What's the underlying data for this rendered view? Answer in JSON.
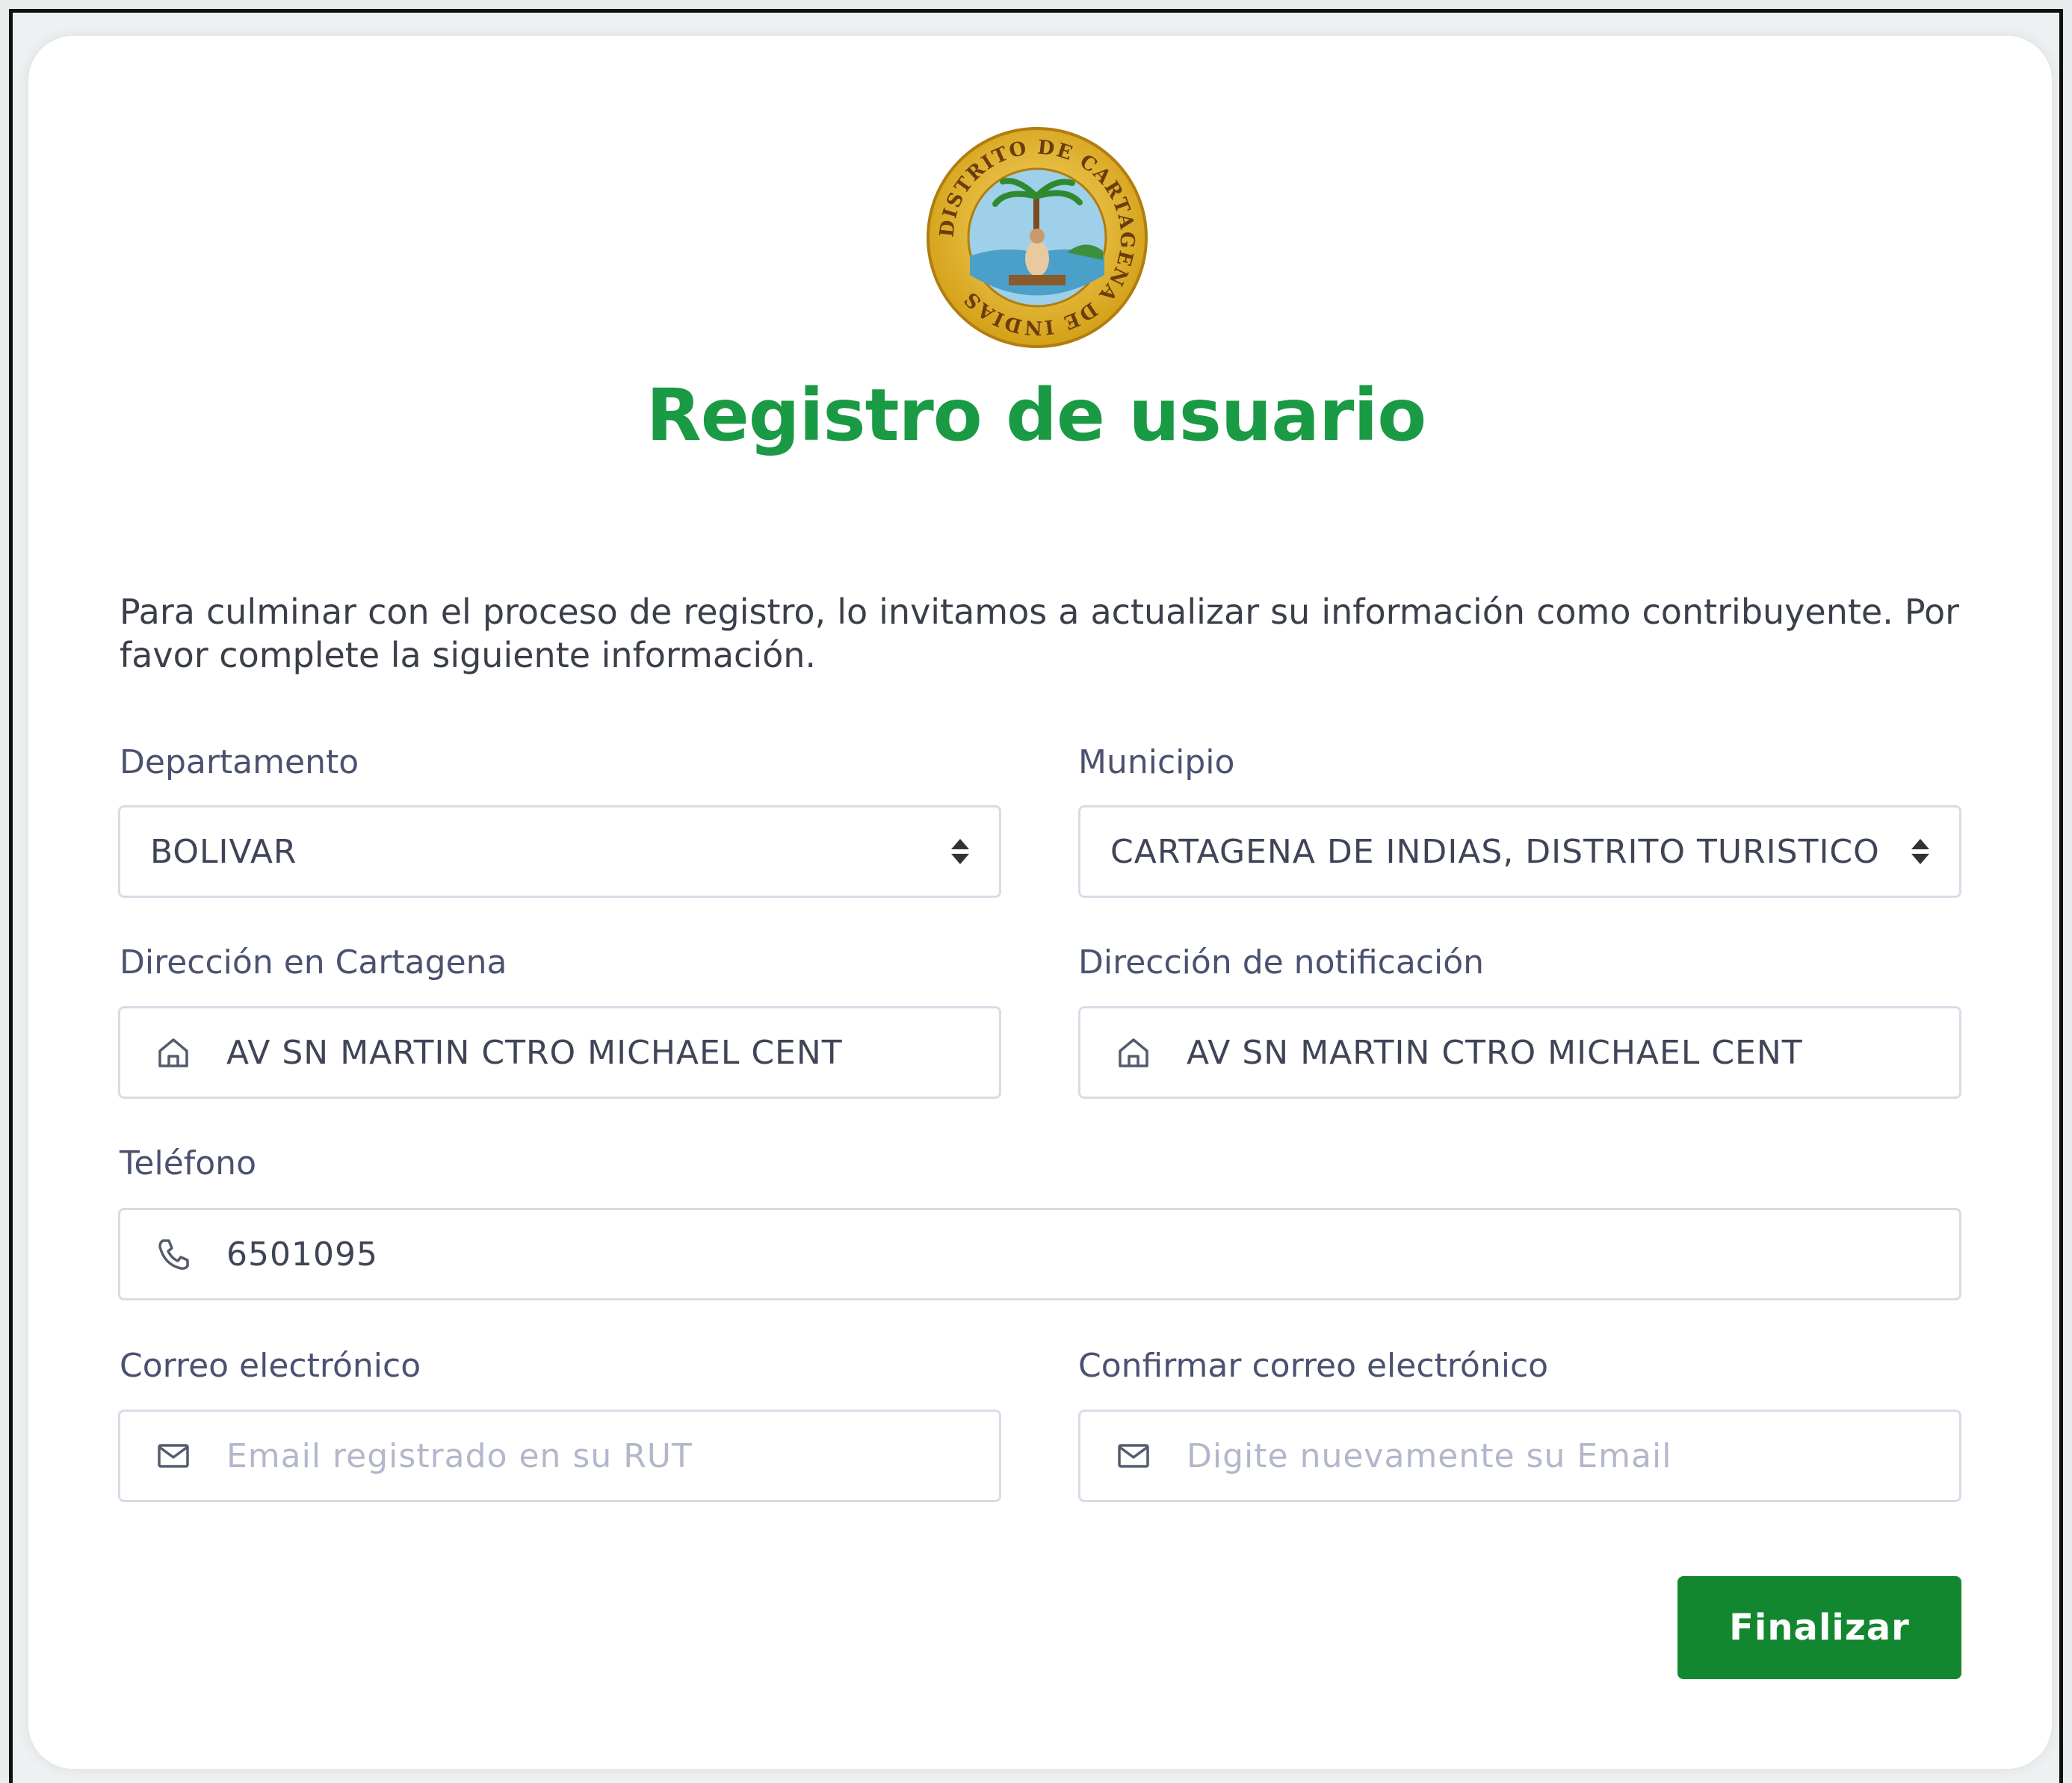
{
  "header": {
    "title": "Registro de usuario",
    "seal_text": "DISTRITO DE CARTAGENA DE INDIAS",
    "intro": "Para culminar con el proceso de registro, lo invitamos a actualizar su información como contribuyente. Por favor complete la siguiente información."
  },
  "form": {
    "departamento": {
      "label": "Departamento",
      "value": "BOLIVAR"
    },
    "municipio": {
      "label": "Municipio",
      "value": "CARTAGENA DE INDIAS, DISTRITO TURISTICO"
    },
    "direccion_cartagena": {
      "label": "Dirección en Cartagena",
      "value": "AV SN MARTIN CTRO MICHAEL CENT",
      "icon": "home-icon"
    },
    "direccion_notificacion": {
      "label": "Dirección de notificación",
      "value": "AV SN MARTIN CTRO MICHAEL CENT",
      "icon": "home-icon"
    },
    "telefono": {
      "label": "Teléfono",
      "value": "6501095",
      "icon": "phone-icon"
    },
    "correo": {
      "label": "Correo electrónico",
      "placeholder": "Email registrado en su RUT",
      "icon": "mail-icon"
    },
    "confirmar_correo": {
      "label": "Confirmar correo electrónico",
      "placeholder": "Digite nuevamente su Email",
      "icon": "mail-icon"
    }
  },
  "actions": {
    "submit_label": "Finalizar"
  },
  "colors": {
    "title": "#1a9a44",
    "button": "#13872f",
    "label": "#4b5170",
    "border": "#d9dce6"
  }
}
